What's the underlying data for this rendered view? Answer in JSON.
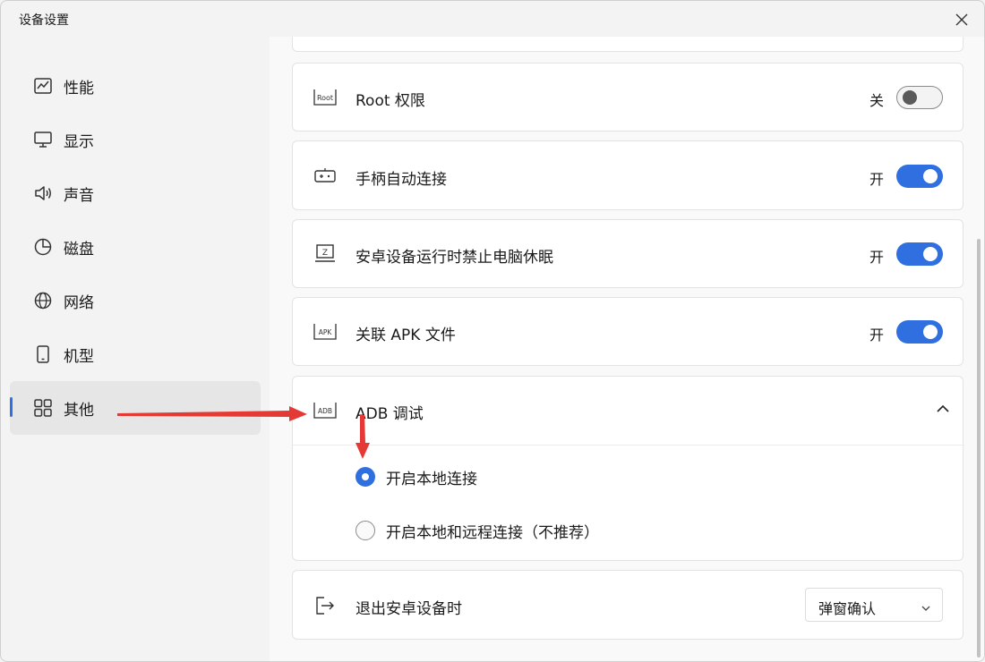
{
  "window": {
    "title": "设备设置"
  },
  "sidebar": {
    "items": [
      {
        "label": "性能",
        "icon": "performance-icon"
      },
      {
        "label": "显示",
        "icon": "monitor-icon"
      },
      {
        "label": "声音",
        "icon": "speaker-icon"
      },
      {
        "label": "磁盘",
        "icon": "disk-pie-icon"
      },
      {
        "label": "网络",
        "icon": "globe-icon"
      },
      {
        "label": "机型",
        "icon": "phone-icon"
      },
      {
        "label": "其他",
        "icon": "grid-icon",
        "active": true
      }
    ]
  },
  "settings": {
    "root": {
      "label": "Root 权限",
      "state": "关",
      "icon_text": "Root",
      "enabled": false
    },
    "gamepad": {
      "label": "手柄自动连接",
      "state": "开",
      "enabled": true
    },
    "nosleep": {
      "label": "安卓设备运行时禁止电脑休眠",
      "state": "开",
      "icon_text": "Z",
      "enabled": true
    },
    "apk": {
      "label": "关联 APK 文件",
      "state": "开",
      "icon_text": "APK",
      "enabled": true
    },
    "adb": {
      "label": "ADB 调试",
      "icon_text": "ADB",
      "expanded": true,
      "options": [
        {
          "label": "开启本地连接",
          "selected": true
        },
        {
          "label": "开启本地和远程连接（不推荐）",
          "selected": false
        }
      ]
    },
    "exit": {
      "label": "退出安卓设备时",
      "value": "弹窗确认"
    }
  },
  "colors": {
    "accent": "#2f6fe0",
    "annotation": "#e53935"
  }
}
